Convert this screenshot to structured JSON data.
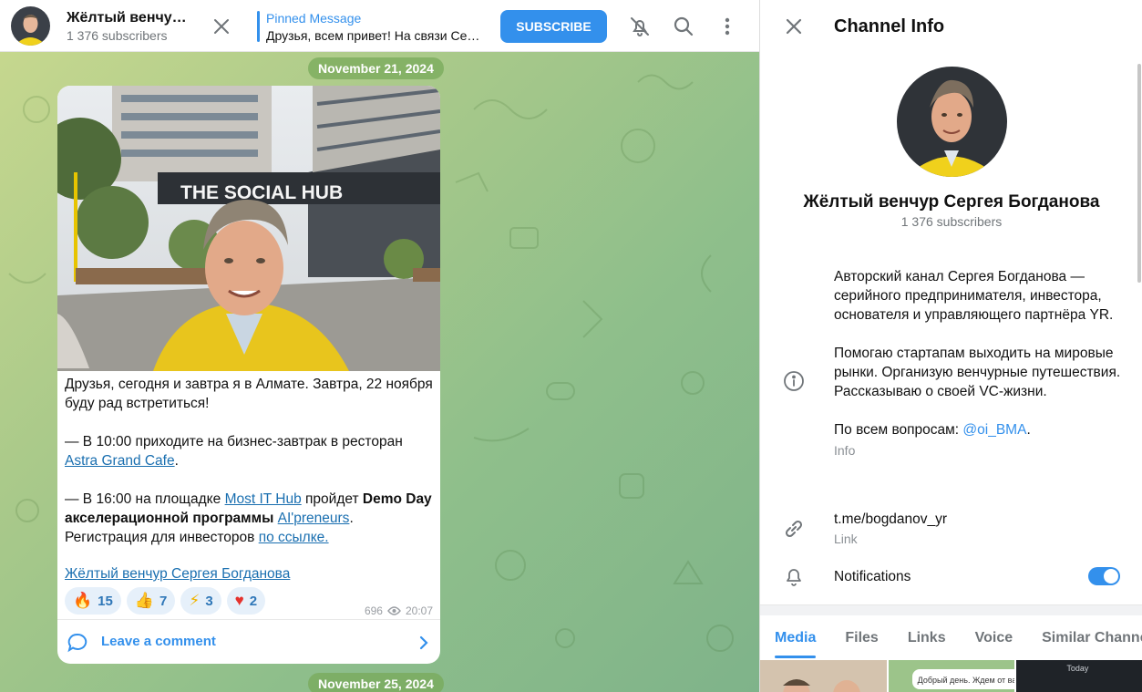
{
  "header": {
    "channel_title": "Жёлтый венчу…",
    "subscribers": "1 376 subscribers",
    "pinned_label": "Pinned Message",
    "pinned_text": "Друзья, всем привет! На связи Се…",
    "subscribe_label": "SUBSCRIBE"
  },
  "chat": {
    "date_top": "November 21, 2024",
    "date_bottom": "November 25, 2024",
    "post": {
      "photo_sign": "THE SOCIAL HUB",
      "p1": "Друзья, сегодня и завтра я в Алмате. Завтра, 22 ноября буду рад встретиться!",
      "p2_pre": "— В 10:00 приходите на бизнес-завтрак в ресторан ",
      "p2_link": "Astra Grand Cafe",
      "p2_post": ".",
      "p3_a": "— В 16:00 на площадке ",
      "p3_link1": "Most IT Hub",
      "p3_b": " пройдет ",
      "p3_bold": "Demo Day акселерационной программы",
      "p3_c": " ",
      "p3_link2": "AI'preneurs",
      "p3_d": ". Регистрация для инвесторов ",
      "p3_link3": "по ссылке.",
      "signature": "Жёлтый венчур Сергея Богданова",
      "reactions": [
        {
          "emoji": "🔥",
          "count": "15"
        },
        {
          "emoji": "👍",
          "count": "7"
        },
        {
          "emoji": "⚡",
          "count": "3"
        },
        {
          "emoji": "♥",
          "count": "2"
        }
      ],
      "views": "696",
      "time": "20:07",
      "comment_label": "Leave a comment"
    }
  },
  "info": {
    "title": "Channel Info",
    "name": "Жёлтый венчур Сергея Богданова",
    "subscribers": "1 376 subscribers",
    "desc1": "Авторский канал Сергея Богданова — серийного предпринимателя, инвестора, основателя и управляющего партнёра YR.",
    "desc2": "Помогаю стартапам выходить на мировые рынки. Организую венчурные путешествия. Рассказываю о своей VC-жизни.",
    "desc3_pre": "По всем вопросам: ",
    "desc3_link": "@oi_BMA",
    "desc3_post": ".",
    "info_caption": "Info",
    "link": "t.me/bogdanov_yr",
    "link_caption": "Link",
    "notifications_label": "Notifications",
    "notifications_on": true,
    "tabs": [
      "Media",
      "Files",
      "Links",
      "Voice",
      "Similar Channels"
    ],
    "active_tab": "Media",
    "thumb_texts": [
      "Добрый день. Ждем от вас",
      "Today"
    ]
  },
  "colors": {
    "accent": "#3390ec",
    "chat_bg": "#a9c98a",
    "yellow_shirt": "#f2d21b"
  },
  "icons": [
    "close-icon",
    "mute-bell-icon",
    "search-icon",
    "more-vertical-icon",
    "eye-icon",
    "comment-icon",
    "chevron-right-icon",
    "info-icon",
    "link-icon",
    "bell-icon"
  ]
}
